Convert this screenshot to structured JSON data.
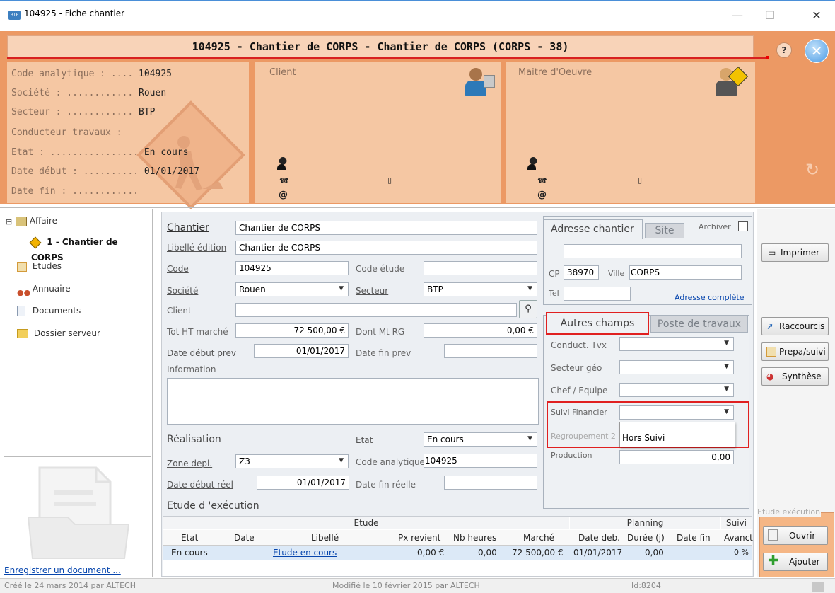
{
  "window": {
    "title": "104925 - Fiche chantier",
    "minimize": "—",
    "maximize": "☐",
    "close": "✕"
  },
  "header": {
    "title": "104925 - Chantier de CORPS - Chantier de CORPS (CORPS - 38)",
    "help": "?"
  },
  "info": {
    "code_label": "Code analytique : ....",
    "code_value": "104925",
    "societe_label": "Société : ............",
    "societe_value": "Rouen",
    "secteur_label": "Secteur : ............",
    "secteur_value": "BTP",
    "conducteur_label": "Conducteur travaux :",
    "etat_label": "Etat : ................",
    "etat_value": "En cours",
    "date_debut_label": "Date début : ..........",
    "date_debut_value": "01/01/2017",
    "date_fin_label": "Date fin : ............"
  },
  "client": {
    "label": "Client",
    "at": "@"
  },
  "moe": {
    "label": "Maitre d'Oeuvre",
    "at": "@"
  },
  "sidebar": {
    "items": [
      {
        "label": "Affaire",
        "icon": "folder-tree-icon"
      },
      {
        "label": "1 - Chantier de CORPS",
        "icon": "warning-sign-icon"
      },
      {
        "label": "Etudes"
      },
      {
        "label": "Annuaire"
      },
      {
        "label": "Documents"
      },
      {
        "label": "Dossier serveur"
      }
    ],
    "tree_toggle": "⊟",
    "register_doc": "Enregistrer un document ..."
  },
  "form": {
    "chantier_label": "Chantier",
    "chantier_value": "Chantier de CORPS",
    "libelle_label": "Libellé édition",
    "libelle_value": "Chantier de CORPS",
    "code_label": "Code",
    "code_value": "104925",
    "code_etude_label": "Code étude",
    "code_etude_value": "",
    "societe_label": "Société",
    "societe_value": "Rouen",
    "secteur_label": "Secteur",
    "secteur_value": "BTP",
    "client_label": "Client",
    "client_value": "",
    "tot_ht_label": "Tot HT marché",
    "tot_ht_value": "72 500,00 €",
    "dont_mt_label": "Dont Mt RG",
    "dont_mt_value": "0,00 €",
    "date_debut_prev_label": "Date début prev",
    "date_debut_prev_value": "01/01/2017",
    "date_fin_prev_label": "Date fin prev",
    "date_fin_prev_value": "",
    "information_label": "Information",
    "information_value": "",
    "realisation_label": "Réalisation",
    "etat_label": "Etat",
    "etat_value": "En cours",
    "zone_label": "Zone depl.",
    "zone_value": "Z3",
    "code_analytique_label": "Code analytique",
    "code_analytique_value": "104925",
    "date_debut_reel_label": "Date début réel",
    "date_debut_reel_value": "01/01/2017",
    "date_fin_reelle_label": "Date fin réelle",
    "date_fin_reelle_value": "",
    "etude_exec_label": "Etude d 'exécution"
  },
  "address": {
    "tab_adresse": "Adresse chantier",
    "tab_site": "Site",
    "archiver": "Archiver",
    "line1": "",
    "cp_label": "CP",
    "cp_value": "38970",
    "ville_label": "Ville",
    "ville_value": "CORPS",
    "tel_label": "Tel",
    "tel_value": "",
    "full_address_link": "Adresse complète"
  },
  "fields": {
    "tab_autres": "Autres champs",
    "tab_poste": "Poste de travaux",
    "conduct_label": "Conduct. Tvx",
    "secteur_geo_label": "Secteur géo",
    "chef_label": "Chef / Equipe",
    "suivi_label": "Suivi Financier",
    "regroupement_label": "Regroupement 2",
    "dropdown_option": "Hors Suivi",
    "production_label": "Production",
    "production_value": "0,00"
  },
  "table": {
    "group_etude": "Etude",
    "group_planning": "Planning",
    "group_suivi": "Suivi",
    "headers": [
      "Etat",
      "Date",
      "Libellé",
      "Px revient",
      "Nb heures",
      "Marché",
      "Date deb.",
      "Durée (j)",
      "Date fin",
      "Avanct"
    ],
    "rows": [
      [
        "En cours",
        "",
        "Etude en cours",
        "0,00 €",
        "0,00",
        "72 500,00 €",
        "01/01/2017",
        "0,00",
        "",
        "0 %"
      ]
    ]
  },
  "actions": {
    "imprimer": "Imprimer",
    "raccourcis": "Raccourcis",
    "prepa": "Prepa/suivi",
    "synthese": "Synthèse",
    "etude_exec": "Etude exécution",
    "ouvrir": "Ouvrir",
    "ajouter": "Ajouter"
  },
  "status": {
    "created": "Créé le 24 mars 2014 par ALTECH",
    "modified": "Modifié le 10 février 2015 par ALTECH",
    "id": "Id:8204"
  },
  "colors": {
    "banner": "#ec9964",
    "panel": "#f5c7a3",
    "highlight": "#e02020",
    "selected_row": "#dce9f7"
  }
}
